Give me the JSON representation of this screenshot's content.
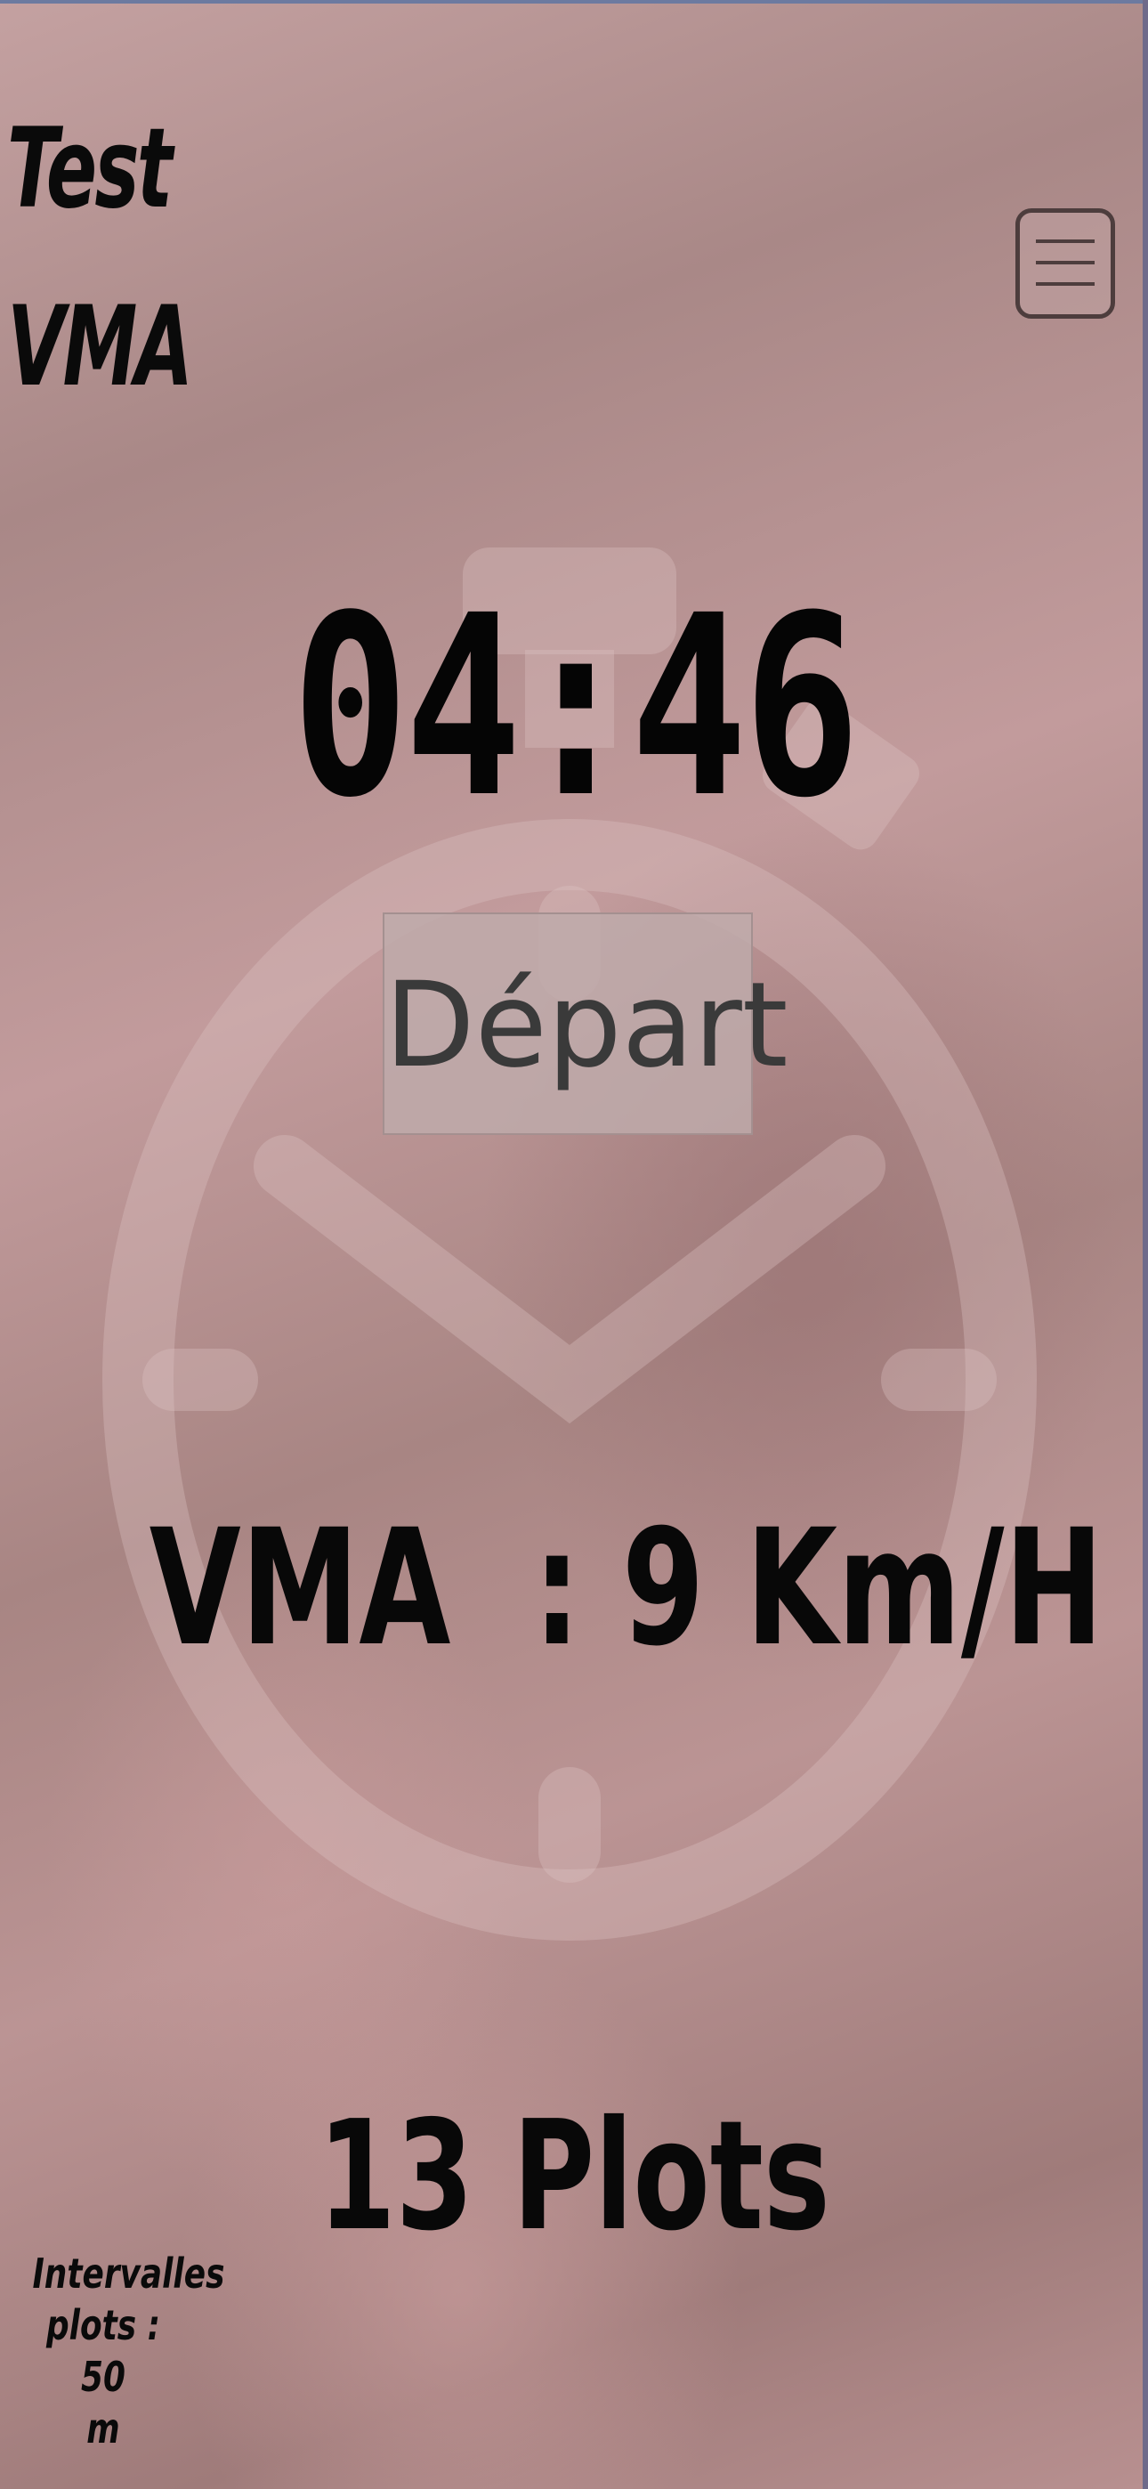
{
  "header": {
    "title_line1": "Test",
    "title_line2": "VMA"
  },
  "icons": {
    "menu": "hamburger-menu-icon",
    "watermark": "stopwatch-icon"
  },
  "timer": {
    "value": "04:46"
  },
  "start_button": {
    "label": "Départ"
  },
  "vma": {
    "text": "VMA  : 9 Km/H"
  },
  "plots": {
    "text": "13 Plots"
  },
  "interval_note": {
    "line1": "Intervalles",
    "line2": "plots : 50",
    "line3": "m"
  },
  "colors": {
    "background": "#b48f8f",
    "text": "#080808",
    "button": "#c1abab"
  }
}
